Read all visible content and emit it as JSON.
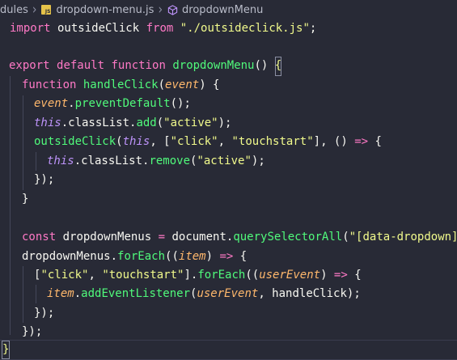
{
  "breadcrumb": {
    "folder": "dules",
    "file": "dropdown-menu.js",
    "symbol": "dropdownMenu"
  },
  "code": {
    "l1": [
      "import",
      " outsideClick ",
      "from",
      " ",
      "\"./outsideclick.js\"",
      ";"
    ],
    "l3": [
      "export",
      " ",
      "default",
      " ",
      "function",
      " ",
      "dropdownMenu",
      "() ",
      "{"
    ],
    "l4": [
      "function",
      " ",
      "handleClick",
      "(",
      "event",
      ") {"
    ],
    "l5": [
      "event",
      ".",
      "preventDefault",
      "();"
    ],
    "l6": [
      "this",
      ".classList.",
      "add",
      "(",
      "\"active\"",
      ");"
    ],
    "l7": [
      "outsideClick",
      "(",
      "this",
      ", [",
      "\"click\"",
      ", ",
      "\"touchstart\"",
      "], () ",
      "=>",
      " {"
    ],
    "l8": [
      "this",
      ".classList.",
      "remove",
      "(",
      "\"active\"",
      ");"
    ],
    "l9": "});",
    "l10": "}",
    "l12": [
      "const",
      " dropdownMenus ",
      "=",
      " document.",
      "querySelectorAll",
      "(",
      "\"[data-dropdown]\"",
      ");"
    ],
    "l13": [
      "dropdownMenus.",
      "forEach",
      "((",
      "item",
      ") ",
      "=>",
      " {"
    ],
    "l14": [
      "[",
      "\"click\"",
      ", ",
      "\"touchstart\"",
      "].",
      "forEach",
      "((",
      "userEvent",
      ") ",
      "=>",
      " {"
    ],
    "l15": [
      "item",
      ".",
      "addEventListener",
      "(",
      "userEvent",
      ", handleClick);"
    ],
    "l16": "});",
    "l17": "});",
    "l18": "}"
  }
}
